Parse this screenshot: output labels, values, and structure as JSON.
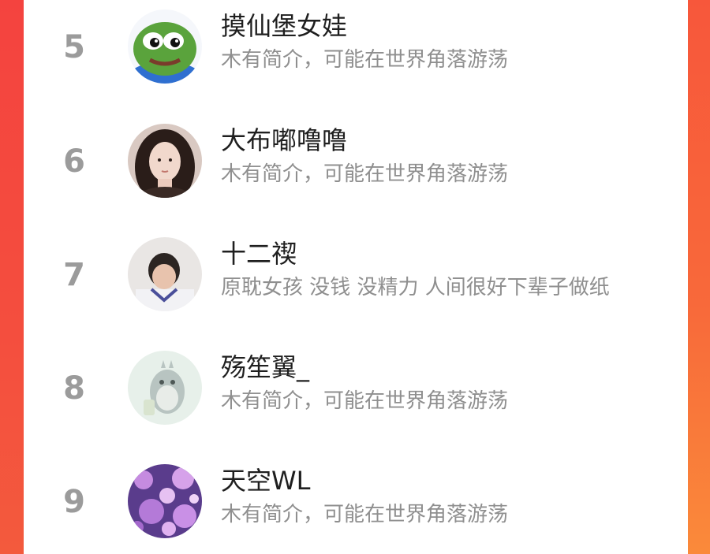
{
  "theme": {
    "accent": "#f64f46",
    "rank_color": "#9b9b9b",
    "name_color": "#1f1f1f",
    "bio_color": "#8f8f8f"
  },
  "ranking": [
    {
      "rank": "5",
      "name": "摸仙堡女娃",
      "bio": "木有简介，可能在世界角落游荡",
      "avatar": "pepe-frog-avatar"
    },
    {
      "rank": "6",
      "name": "大布嘟噜噜",
      "bio": "木有简介，可能在世界角落游荡",
      "avatar": "girl-portrait-avatar"
    },
    {
      "rank": "7",
      "name": "十二禊",
      "bio": "原耽女孩 没钱 没精力 人间很好下辈子做纸",
      "avatar": "boy-photo-avatar"
    },
    {
      "rank": "8",
      "name": "殇笙翼_",
      "bio": "木有简介，可能在世界角落游荡",
      "avatar": "totoro-avatar"
    },
    {
      "rank": "9",
      "name": "天空WL",
      "bio": "木有简介，可能在世界角落游荡",
      "avatar": "purple-blossom-avatar"
    }
  ]
}
